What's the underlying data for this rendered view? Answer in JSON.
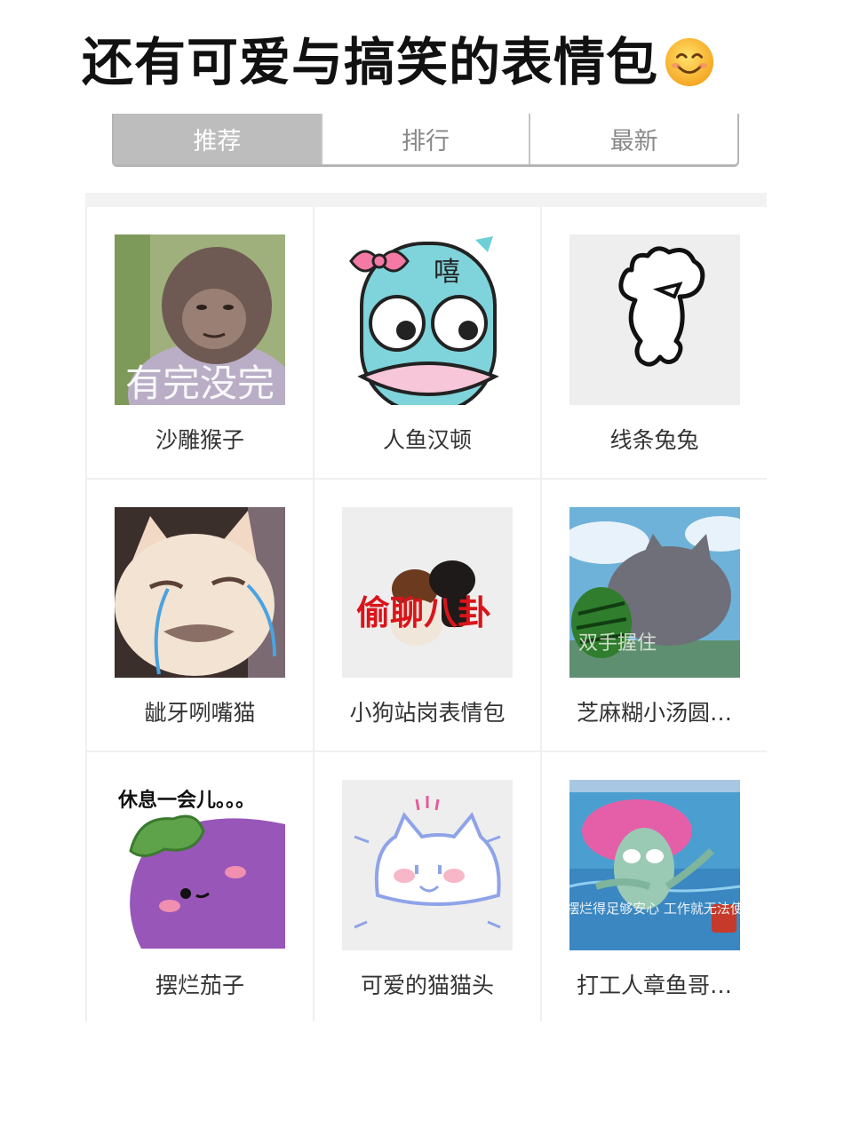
{
  "headline": "还有可爱与搞笑的表情包",
  "headline_emoji": "smiling-face-emoji",
  "tabs": [
    {
      "label": "推荐",
      "active": true
    },
    {
      "label": "排行",
      "active": false
    },
    {
      "label": "最新",
      "active": false
    }
  ],
  "stickers": [
    {
      "title": "沙雕猴子",
      "overlay": "有完没完"
    },
    {
      "title": "人鱼汉顿",
      "overlay": "嘻"
    },
    {
      "title": "线条兔兔"
    },
    {
      "title": "龇牙咧嘴猫"
    },
    {
      "title": "小狗站岗表情包",
      "overlay": "偷聊八卦"
    },
    {
      "title": "芝麻糊小汤圆…",
      "overlay": "双手握住"
    },
    {
      "title": "摆烂茄子",
      "overlay": "休息一会儿。。。"
    },
    {
      "title": "可爱的猫猫头"
    },
    {
      "title": "打工人章鱼哥…",
      "overlay": "只要我摆烂得足够安心 工作就无法使我烦心"
    }
  ],
  "colors": {
    "tab_active_bg": "#bdbdbd",
    "tab_text": "#888888",
    "caption": "#333333"
  }
}
